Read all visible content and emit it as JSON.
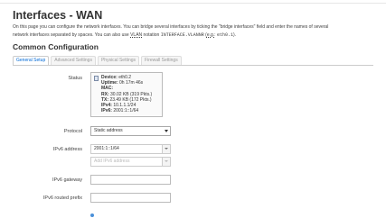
{
  "header": {
    "title": "Interfaces - WAN",
    "description_1": "On this page you can configure the network interfaces. You can bridge several interfaces by ticking the \"bridge interfaces\" field and enter the names of several",
    "description_2_pre": "network interfaces separated by spaces. You can also use ",
    "vlan_abbr": "VLAN",
    "description_2_mid": " notation ",
    "vlan_code": "INTERFACE.VLANNR",
    "description_2_paren_open": " (",
    "eg_abbr": "e.g.",
    "description_2_sep": ": ",
    "eg_code": "eth0.1",
    "description_2_end": ")."
  },
  "section": {
    "title": "Common Configuration"
  },
  "tabs": [
    {
      "label": "General Setup",
      "active": true
    },
    {
      "label": "Advanced Settings",
      "active": false
    },
    {
      "label": "Physical Settings",
      "active": false
    },
    {
      "label": "Firewall Settings",
      "active": false
    }
  ],
  "status": {
    "label": "Status",
    "icon": "ethernet-port-icon",
    "device_label": "Device:",
    "device_value": "eth0.2",
    "uptime_label": "Uptime:",
    "uptime_value": "0h 17m 46s",
    "mac_label": "MAC:",
    "mac_value": "",
    "rx_label": "RX:",
    "rx_value": "30.02 KB (319 Pkts.)",
    "tx_label": "TX:",
    "tx_value": "23.49 KB (172 Pkts.)",
    "ipv4_label": "IPv4:",
    "ipv4_value": "10.1.1.1/24",
    "ipv6_label": "IPv6:",
    "ipv6_value": "2001:1::1/64"
  },
  "protocol": {
    "label": "Protocol",
    "value": "Static address"
  },
  "ipv6_address": {
    "label": "IPv6 address",
    "value": "2001:1::1/64",
    "placeholder": "Add IPv6 address"
  },
  "ipv6_gateway": {
    "label": "IPv6 gateway",
    "value": ""
  },
  "ipv6_routed_prefix": {
    "label": "IPv6 routed prefix",
    "value": ""
  },
  "colors": {
    "tab_active_text": "#0069d6",
    "radio_accent": "#4a90d9"
  }
}
